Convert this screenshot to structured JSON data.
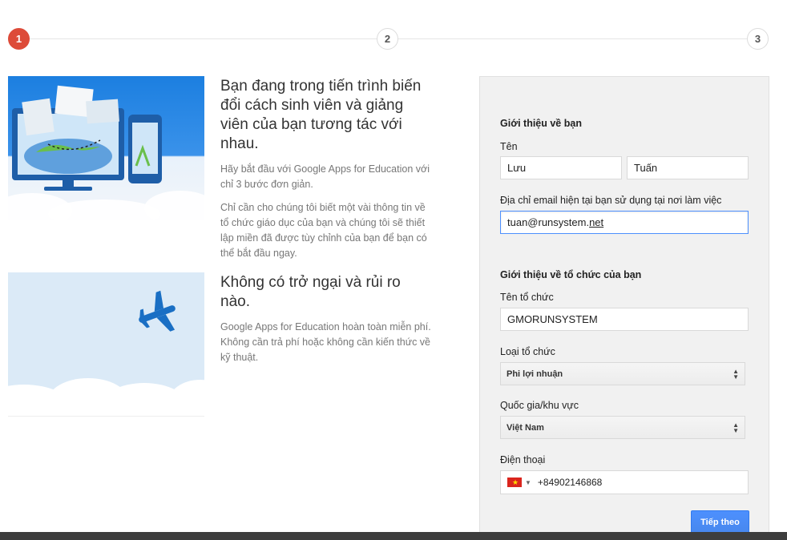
{
  "stepper": {
    "steps": [
      "1",
      "2",
      "3"
    ]
  },
  "features": [
    {
      "title": "Bạn đang trong tiến trình biến đổi cách sinh viên và giảng viên của bạn tương tác với nhau.",
      "paragraphs": [
        "Hãy bắt đầu với Google Apps for Education với chỉ 3 bước đơn giản.",
        "Chỉ cần cho chúng tôi biết một vài thông tin về tổ chức giáo dục của bạn và chúng tôi sẽ thiết lập miền đã được tùy chỉnh của bạn để bạn có thể bắt đầu ngay."
      ]
    },
    {
      "title": "Không có trở ngại và rủi ro nào.",
      "paragraphs": [
        "Google Apps for Education hoàn toàn miễn phí. Không cần trả phí hoặc không cần kiến thức về kỹ thuật."
      ]
    }
  ],
  "form": {
    "about_you_title": "Giới thiệu về bạn",
    "name_label": "Tên",
    "first_name": "Lưu",
    "last_name": "Tuấn",
    "email_label": "Địa chỉ email hiện tại bạn sử dụng tại nơi làm việc",
    "email_prefix": "tuan@runsystem.",
    "email_suffix": "net",
    "org_title": "Giới thiệu về tổ chức của bạn",
    "org_name_label": "Tên tổ chức",
    "org_name": "GMORUNSYSTEM",
    "org_type_label": "Loại tổ chức",
    "org_type": "Phi lợi nhuận",
    "country_label": "Quốc gia/khu vực",
    "country": "Việt Nam",
    "phone_label": "Điện thoại",
    "phone": "+84902146868",
    "next_button": "Tiếp theo"
  },
  "colors": {
    "accent": "#dd4b39",
    "button": "#4d90fe",
    "panel": "#f1f1f1"
  }
}
